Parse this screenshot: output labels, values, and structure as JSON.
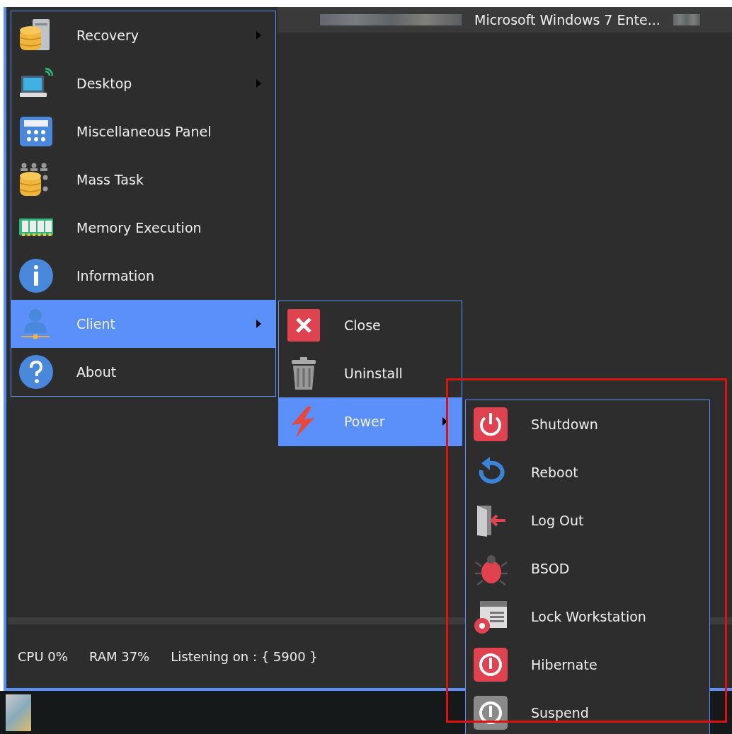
{
  "title_bar": {
    "text": "Microsoft Windows 7 Ente..."
  },
  "main_menu": [
    {
      "label": "Recovery",
      "has_submenu": true,
      "selected": false
    },
    {
      "label": "Desktop",
      "has_submenu": true,
      "selected": false
    },
    {
      "label": "Miscellaneous Panel",
      "has_submenu": false,
      "selected": false
    },
    {
      "label": "Mass Task",
      "has_submenu": false,
      "selected": false
    },
    {
      "label": "Memory Execution",
      "has_submenu": false,
      "selected": false
    },
    {
      "label": "Information",
      "has_submenu": false,
      "selected": false
    },
    {
      "label": "Client",
      "has_submenu": true,
      "selected": true
    },
    {
      "label": "About",
      "has_submenu": false,
      "selected": false
    }
  ],
  "client_menu": [
    {
      "label": "Close",
      "has_submenu": false,
      "selected": false
    },
    {
      "label": "Uninstall",
      "has_submenu": false,
      "selected": false
    },
    {
      "label": "Power",
      "has_submenu": true,
      "selected": true
    }
  ],
  "power_menu": [
    {
      "label": "Shutdown",
      "has_submenu": false,
      "selected": false
    },
    {
      "label": "Reboot",
      "has_submenu": false,
      "selected": false
    },
    {
      "label": "Log Out",
      "has_submenu": false,
      "selected": false
    },
    {
      "label": "BSOD",
      "has_submenu": false,
      "selected": false
    },
    {
      "label": "Lock Workstation",
      "has_submenu": false,
      "selected": false
    },
    {
      "label": "Hibernate",
      "has_submenu": false,
      "selected": false
    },
    {
      "label": "Suspend",
      "has_submenu": false,
      "selected": false
    }
  ],
  "status_bar": [
    "CPU 0%",
    "RAM 37%",
    "Listening on : { 5900 }"
  ]
}
